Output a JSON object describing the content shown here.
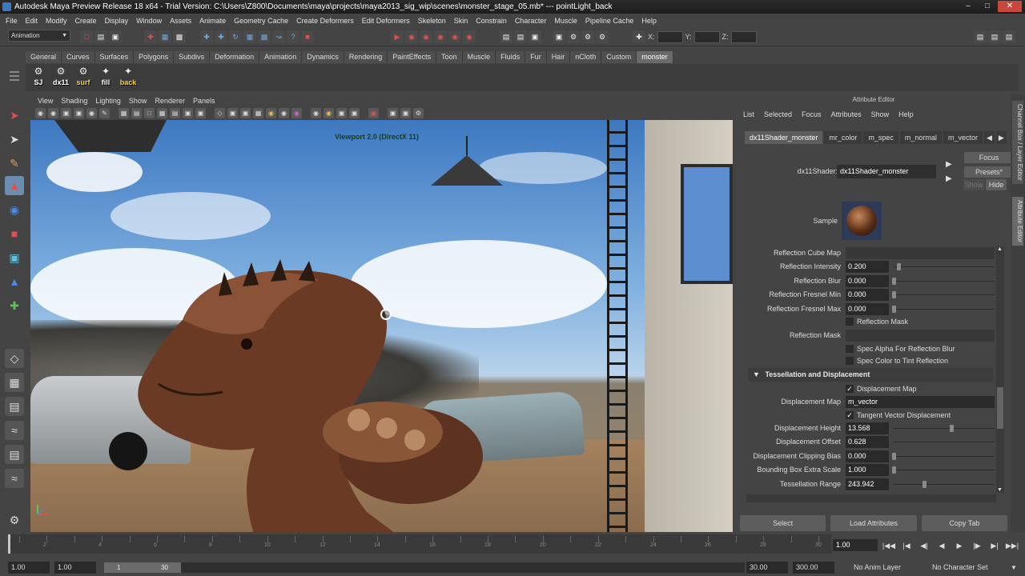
{
  "window": {
    "title": "Autodesk Maya Preview Release 18 x64 - Trial Version: C:\\Users\\Z800\\Documents\\maya\\projects\\maya2013_sig_wip\\scenes\\monster_stage_05.mb*   ---   pointLight_back"
  },
  "menubar": [
    "File",
    "Edit",
    "Modify",
    "Create",
    "Display",
    "Window",
    "Assets",
    "Animate",
    "Geometry Cache",
    "Create Deformers",
    "Edit Deformers",
    "Skeleton",
    "Skin",
    "Constrain",
    "Character",
    "Muscle",
    "Pipeline Cache",
    "Help"
  ],
  "statusline": {
    "mode": "Animation",
    "x_label": "X:",
    "y_label": "Y:",
    "z_label": "Z:"
  },
  "shelf": {
    "tabs": [
      "General",
      "Curves",
      "Surfaces",
      "Polygons",
      "Subdivs",
      "Deformation",
      "Animation",
      "Dynamics",
      "Rendering",
      "PaintEffects",
      "Toon",
      "Muscle",
      "Fluids",
      "Fur",
      "Hair",
      "nCloth",
      "Custom",
      "monster"
    ],
    "active_tab": "monster",
    "buttons": [
      {
        "label": "SJ",
        "icon": "script-icon"
      },
      {
        "label": "dx11",
        "icon": "script-icon"
      },
      {
        "label": "surf",
        "icon": "surface-icon"
      },
      {
        "label": "fill",
        "icon": "light-icon"
      },
      {
        "label": "back",
        "icon": "light-icon"
      }
    ]
  },
  "viewport": {
    "menu": [
      "View",
      "Shading",
      "Lighting",
      "Show",
      "Renderer",
      "Panels"
    ],
    "label": "Viewport 2.0 (DirectX 11)"
  },
  "attribute_editor": {
    "title": "Attribute Editor",
    "menu": [
      "List",
      "Selected",
      "Focus",
      "Attributes",
      "Show",
      "Help"
    ],
    "tabs": [
      "dx11Shader_monster",
      "mr_color",
      "m_spec",
      "m_normal",
      "m_vector"
    ],
    "active_tab": "dx11Shader_monster",
    "focus_button": "Focus",
    "presets_button": "Presets*",
    "show_button": "Show",
    "hide_button": "Hide",
    "shader_label": "dx11Shader:",
    "shader_name": "dx11Shader_monster",
    "sample_label": "Sample",
    "reflection_cube_map": "Reflection Cube Map",
    "reflection_intensity": {
      "label": "Reflection Intensity",
      "value": "0.200"
    },
    "reflection_blur": {
      "label": "Reflection Blur",
      "value": "0.000"
    },
    "reflection_fresnel_min": {
      "label": "Reflection Fresnel Min",
      "value": "0.000"
    },
    "reflection_fresnel_max": {
      "label": "Reflection Fresnel Max",
      "value": "0.000"
    },
    "reflection_mask_check": "Reflection Mask",
    "reflection_mask_label": "Reflection Mask",
    "spec_alpha": "Spec Alpha For Reflection Blur",
    "spec_color": "Spec Color to Tint Reflection",
    "section_tessellation": "Tessellation and Displacement",
    "displacement_map_check": "Displacement Map",
    "displacement_map": {
      "label": "Displacement Map",
      "value": "m_vector"
    },
    "tangent_vector": "Tangent Vector Displacement",
    "displacement_height": {
      "label": "Displacement Height",
      "value": "13.568"
    },
    "displacement_offset": {
      "label": "Displacement Offset",
      "value": "0.628"
    },
    "displacement_clipping_bias": {
      "label": "Displacement Clipping Bias",
      "value": "0.000"
    },
    "bounding_box_extra_scale": {
      "label": "Bounding Box Extra Scale",
      "value": "1.000"
    },
    "tessellation_range": {
      "label": "Tessellation Range",
      "value": "243.942"
    },
    "bottom_buttons": [
      "Select",
      "Load Attributes",
      "Copy Tab"
    ]
  },
  "right_tabs": [
    "Channel Box / Layer Editor",
    "Attribute Editor"
  ],
  "timeline": {
    "current_frame": "1.00",
    "ticks": [
      "2",
      "4",
      "6",
      "8",
      "10",
      "12",
      "14",
      "16",
      "18",
      "20",
      "22",
      "24",
      "26",
      "28",
      "30"
    ]
  },
  "range": {
    "start": "1.00",
    "start_inner": "1.00",
    "range_start": "1",
    "range_end": "30",
    "end_inner": "30.00",
    "end": "300.00",
    "anim_layer": "No Anim Layer",
    "character_set": "No Character Set"
  }
}
